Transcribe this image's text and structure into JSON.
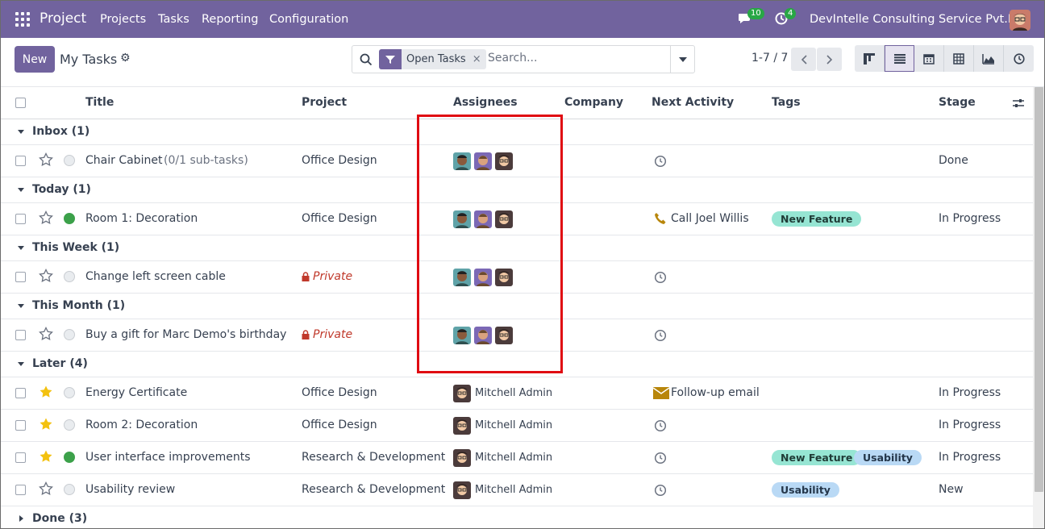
{
  "navbar": {
    "brand": "Project",
    "menus": [
      "Projects",
      "Tasks",
      "Reporting",
      "Configuration"
    ],
    "messages_count": "10",
    "activities_count": "4",
    "company": "DevIntelle Consulting Service Pvt.Ltd",
    "icons": [
      "apps-grid-icon",
      "chat-icon",
      "clock-icon",
      "user-avatar"
    ]
  },
  "control": {
    "new_label": "New",
    "title": "My Tasks",
    "facet": "Open Tasks",
    "facet_remove": "×",
    "search_placeholder": "Search...",
    "pager": "1-7 / 7",
    "views": [
      "kanban",
      "list",
      "calendar",
      "pivot",
      "graph",
      "activity"
    ],
    "active_view": "list"
  },
  "columns": {
    "title": "Title",
    "project": "Project",
    "assignees": "Assignees",
    "company": "Company",
    "next_activity": "Next Activity",
    "tags": "Tags",
    "stage": "Stage"
  },
  "groups": [
    {
      "name": "Inbox (1)",
      "open": true
    },
    {
      "name": "Today (1)",
      "open": true
    },
    {
      "name": "This Week (1)",
      "open": true
    },
    {
      "name": "This Month (1)",
      "open": true
    },
    {
      "name": "Later (4)",
      "open": true
    },
    {
      "name": "Done (3)",
      "open": false
    }
  ],
  "tasks": [
    {
      "title": "Chair Cabinet",
      "subtasks": "(0/1 sub-tasks)",
      "project": "Office Design",
      "assignee": "",
      "activity": "",
      "stage": "Done",
      "starred": false,
      "status": "grey"
    },
    {
      "title": "Room 1: Decoration",
      "subtasks": "",
      "project": "Office Design",
      "assignee": "",
      "activity": "Call Joel Willis",
      "tag1": "New Feature",
      "stage": "In Progress",
      "starred": false,
      "status": "green"
    },
    {
      "title": "Change left screen cable",
      "subtasks": "",
      "project": "Private",
      "assignee": "",
      "activity": "",
      "stage": "",
      "starred": false,
      "status": "grey"
    },
    {
      "title": "Buy a gift for Marc Demo's birthday",
      "subtasks": "",
      "project": "Private",
      "assignee": "",
      "activity": "",
      "stage": "",
      "starred": false,
      "status": "grey"
    },
    {
      "title": "Energy Certificate",
      "subtasks": "",
      "project": "Office Design",
      "assignee": "Mitchell Admin",
      "activity": "Follow-up email",
      "stage": "In Progress",
      "starred": true,
      "status": "grey"
    },
    {
      "title": "Room 2: Decoration",
      "subtasks": "",
      "project": "Office Design",
      "assignee": "Mitchell Admin",
      "activity": "",
      "stage": "In Progress",
      "starred": true,
      "status": "grey"
    },
    {
      "title": "User interface improvements",
      "subtasks": "",
      "project": "Research & Development",
      "assignee": "Mitchell Admin",
      "activity": "",
      "tag1": "New Feature",
      "tag2": "Usability",
      "stage": "In Progress",
      "starred": true,
      "status": "green"
    },
    {
      "title": "Usability review",
      "subtasks": "",
      "project": "Research & Development",
      "assignee": "Mitchell Admin",
      "activity": "",
      "tag1": "Usability",
      "stage": "New",
      "starred": false,
      "status": "grey"
    }
  ],
  "colors": {
    "brand": "#71639e",
    "highlight": "#e00b12",
    "tag_new_feature": "#96e5d3",
    "tag_usability": "#b9d9f5"
  }
}
